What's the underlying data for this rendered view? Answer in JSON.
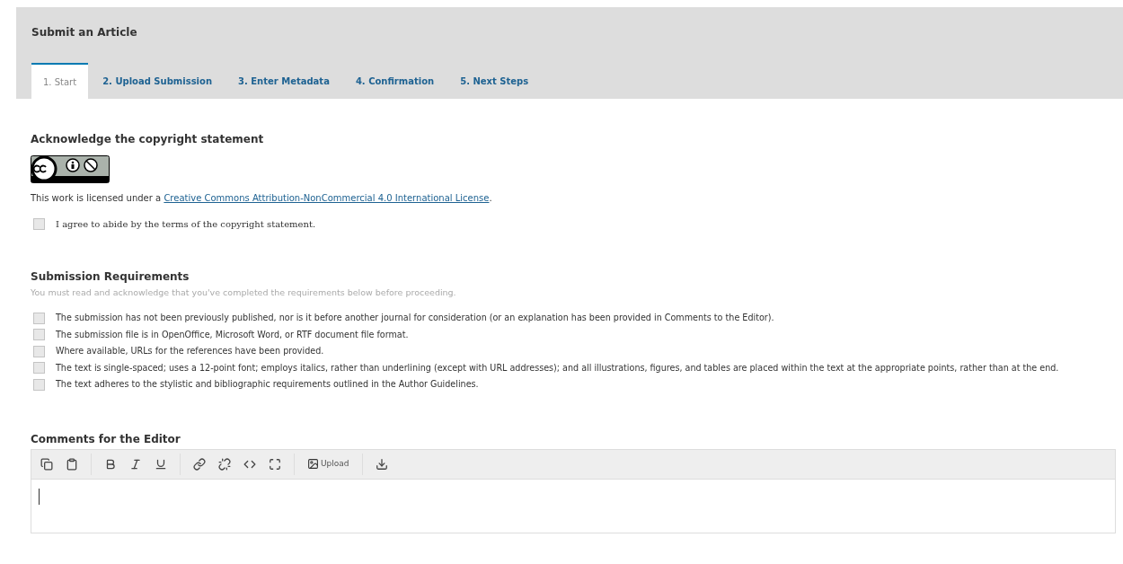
{
  "header": {
    "title": "Submit an Article"
  },
  "tabs": [
    {
      "label": "1. Start",
      "selected": true
    },
    {
      "label": "2. Upload Submission",
      "selected": false
    },
    {
      "label": "3. Enter Metadata",
      "selected": false
    },
    {
      "label": "4. Confirmation",
      "selected": false
    },
    {
      "label": "5. Next Steps",
      "selected": false
    }
  ],
  "copyright": {
    "heading": "Acknowledge the copyright statement",
    "license_prefix": "This work is licensed under a ",
    "license_link": "Creative Commons Attribution-NonCommercial 4.0 International License",
    "license_suffix": ".",
    "agree": {
      "label": "I agree to abide by the terms of the copyright statement.",
      "checked": false
    }
  },
  "requirements": {
    "heading": "Submission Requirements",
    "description": "You must read and acknowledge that you've completed the requirements below before proceeding.",
    "items": [
      {
        "label": "The submission has not been previously published, nor is it before another journal for consideration (or an explanation has been provided in Comments to the Editor).",
        "checked": false
      },
      {
        "label": "The submission file is in OpenOffice, Microsoft Word, or RTF document file format.",
        "checked": false
      },
      {
        "label": "Where available, URLs for the references have been provided.",
        "checked": false
      },
      {
        "label": "The text is single-spaced; uses a 12-point font; employs italics, rather than underlining (except with URL addresses); and all illustrations, figures, and tables are placed within the text at the appropriate points, rather than at the end.",
        "checked": false
      },
      {
        "label": "The text adheres to the stylistic and bibliographic requirements outlined in the Author Guidelines.",
        "checked": false
      }
    ]
  },
  "comments": {
    "heading": "Comments for the Editor",
    "toolbar": [
      {
        "kind": "copy"
      },
      {
        "kind": "paste"
      },
      {
        "kind": "bold"
      },
      {
        "kind": "italic"
      },
      {
        "kind": "underline"
      },
      {
        "kind": "link"
      },
      {
        "kind": "unlink"
      },
      {
        "kind": "code"
      },
      {
        "kind": "fullscreen"
      },
      {
        "kind": "upload",
        "label": "Upload"
      },
      {
        "kind": "download"
      }
    ]
  }
}
